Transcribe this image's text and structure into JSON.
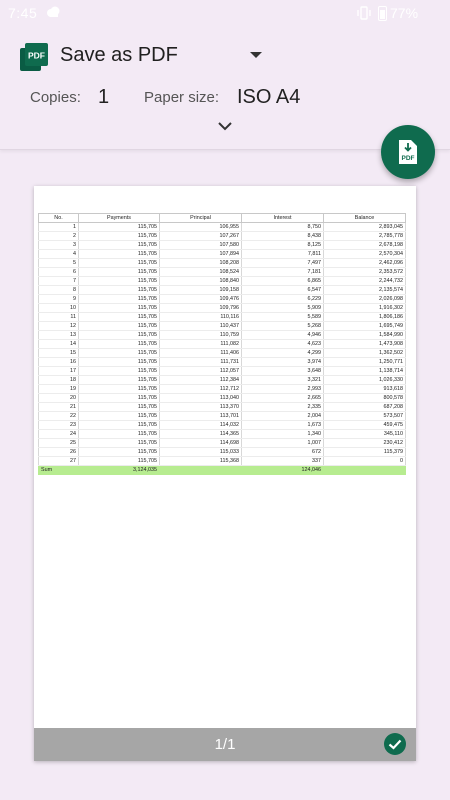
{
  "status_bar": {
    "time": "7:45",
    "battery": "77%"
  },
  "header": {
    "printer_name": "Save as PDF",
    "copies_label": "Copies:",
    "copies_value": "1",
    "paper_size_label": "Paper size:",
    "paper_size_value": "ISO A4"
  },
  "fab": {
    "icon": "download-pdf-icon",
    "label": "PDF"
  },
  "pdf_logo": {
    "label": "PDF"
  },
  "colors": {
    "accent": "#0f6b4e",
    "background": "#f3eaf5",
    "sum_row": "#b7ec90",
    "footer": "#a6a6a6"
  },
  "preview": {
    "page_indicator": "1/1",
    "table": {
      "headers": [
        "No.",
        "Payments",
        "Principal",
        "Interest",
        "Balance"
      ],
      "rows": [
        [
          "1",
          "115,705",
          "106,955",
          "8,750",
          "2,893,045"
        ],
        [
          "2",
          "115,705",
          "107,267",
          "8,438",
          "2,785,778"
        ],
        [
          "3",
          "115,705",
          "107,580",
          "8,125",
          "2,678,198"
        ],
        [
          "4",
          "115,705",
          "107,894",
          "7,811",
          "2,570,304"
        ],
        [
          "5",
          "115,705",
          "108,208",
          "7,497",
          "2,462,096"
        ],
        [
          "6",
          "115,705",
          "108,524",
          "7,181",
          "2,353,572"
        ],
        [
          "7",
          "115,705",
          "108,840",
          "6,865",
          "2,244,732"
        ],
        [
          "8",
          "115,705",
          "109,158",
          "6,547",
          "2,135,574"
        ],
        [
          "9",
          "115,705",
          "109,476",
          "6,229",
          "2,026,098"
        ],
        [
          "10",
          "115,705",
          "109,796",
          "5,909",
          "1,916,302"
        ],
        [
          "11",
          "115,705",
          "110,116",
          "5,589",
          "1,806,186"
        ],
        [
          "12",
          "115,705",
          "110,437",
          "5,268",
          "1,695,749"
        ],
        [
          "13",
          "115,705",
          "110,759",
          "4,946",
          "1,584,990"
        ],
        [
          "14",
          "115,705",
          "111,082",
          "4,623",
          "1,473,908"
        ],
        [
          "15",
          "115,705",
          "111,406",
          "4,299",
          "1,362,502"
        ],
        [
          "16",
          "115,705",
          "111,731",
          "3,974",
          "1,250,771"
        ],
        [
          "17",
          "115,705",
          "112,057",
          "3,648",
          "1,138,714"
        ],
        [
          "18",
          "115,705",
          "112,384",
          "3,321",
          "1,026,330"
        ],
        [
          "19",
          "115,705",
          "112,712",
          "2,993",
          "913,618"
        ],
        [
          "20",
          "115,705",
          "113,040",
          "2,665",
          "800,578"
        ],
        [
          "21",
          "115,705",
          "113,370",
          "2,335",
          "687,208"
        ],
        [
          "22",
          "115,705",
          "113,701",
          "2,004",
          "573,507"
        ],
        [
          "23",
          "115,705",
          "114,032",
          "1,673",
          "459,475"
        ],
        [
          "24",
          "115,705",
          "114,365",
          "1,340",
          "345,110"
        ],
        [
          "25",
          "115,705",
          "114,698",
          "1,007",
          "230,412"
        ],
        [
          "26",
          "115,705",
          "115,033",
          "672",
          "115,379"
        ],
        [
          "27",
          "115,705",
          "115,368",
          "337",
          "0"
        ]
      ],
      "sum_row": [
        "Sum",
        "3,124,035",
        "",
        "124,046",
        ""
      ]
    }
  }
}
